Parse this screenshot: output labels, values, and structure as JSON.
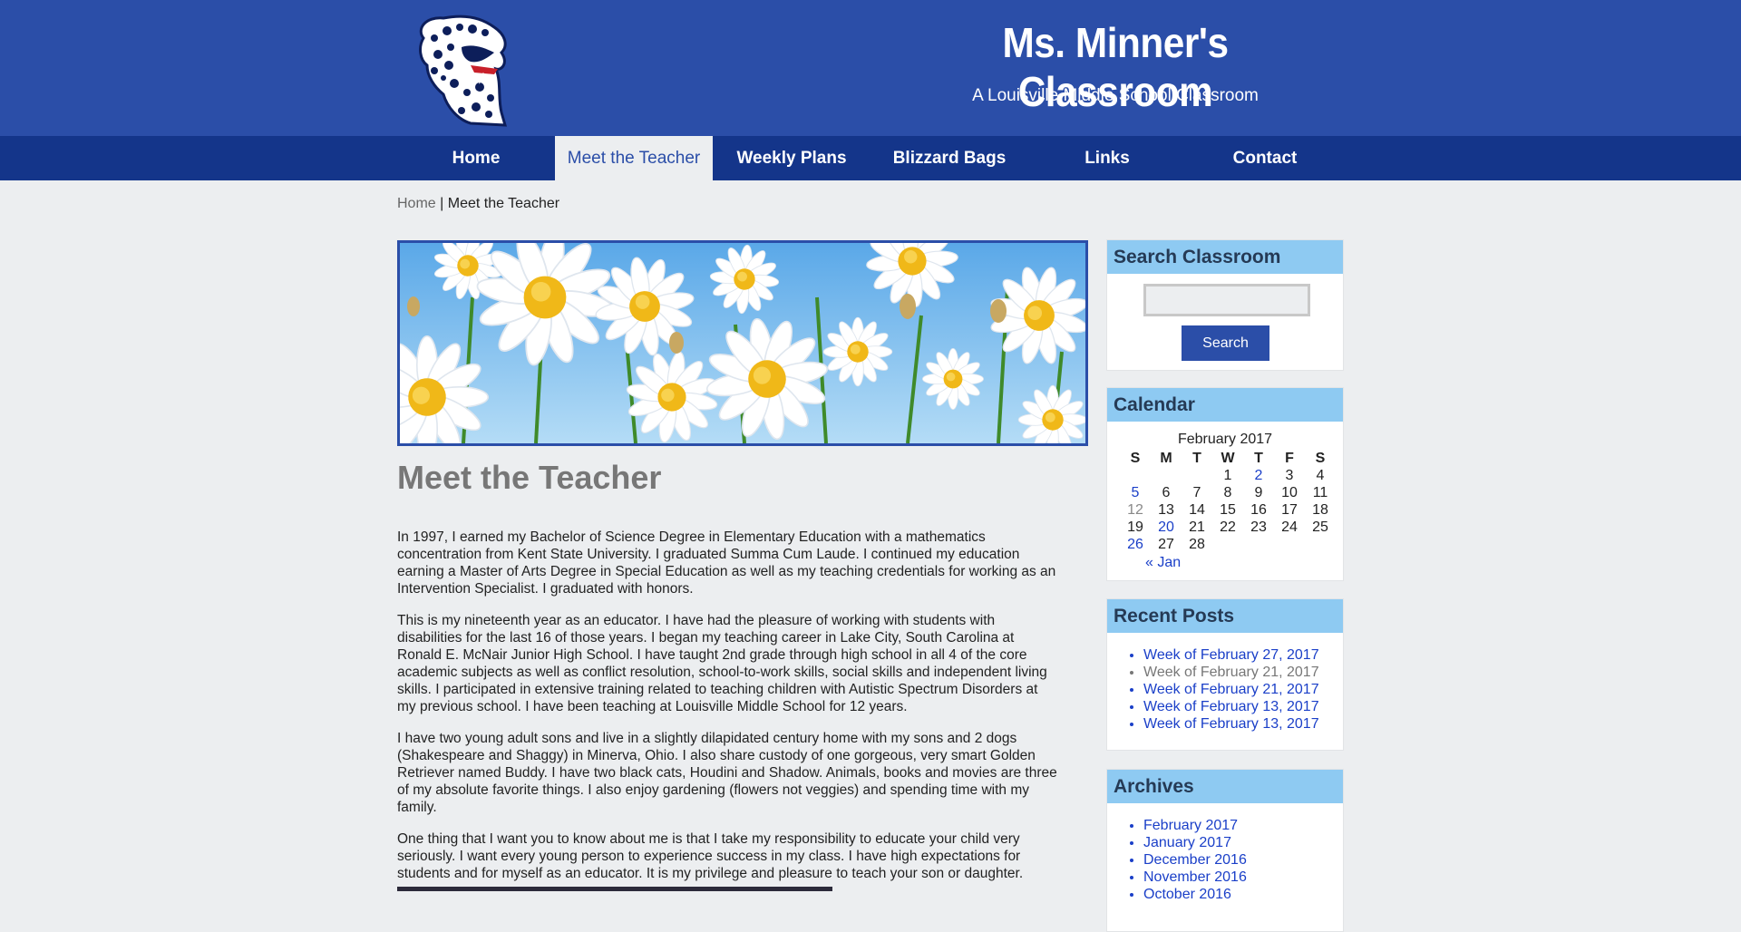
{
  "header": {
    "title": "Ms. Minner's Classroom",
    "subtitle": "A Louisville Middle School Classroom",
    "logo_icon": "jaguar-mascot-logo",
    "colors": {
      "header_bg": "#2b4ea8",
      "nav_bg": "#14358a",
      "widget_title_bg": "#8ecaf2"
    }
  },
  "nav": {
    "items": [
      {
        "label": "Home"
      },
      {
        "label": "Meet the Teacher"
      },
      {
        "label": "Weekly Plans"
      },
      {
        "label": "Blizzard Bags"
      },
      {
        "label": "Links"
      },
      {
        "label": "Contact"
      }
    ],
    "active": "Meet the Teacher"
  },
  "breadcrumb": {
    "home": "Home",
    "separator": " | ",
    "current": "Meet the Teacher"
  },
  "main": {
    "title": "Meet the Teacher",
    "paragraphs": [
      "In 1997, I earned my Bachelor of Science Degree in Elementary Education with a mathematics concentration from Kent State University. I graduated Summa Cum Laude. I continued my education earning a Master of Arts Degree in Special Education as well as my teaching credentials for working as an Intervention Specialist. I graduated with honors.",
      "This is my nineteenth year as an educator. I have had the pleasure of working with students with disabilities for the last 16 of those years. I began my teaching career in Lake City, South Carolina at Ronald E. McNair Junior High School. I have taught 2nd grade through high school in all 4 of the core academic subjects as well as conflict resolution, school-to-work skills, social skills and independent living skills. I participated in extensive training related to teaching children with Autistic Spectrum Disorders at my previous school. I have been teaching at Louisville Middle School for 12 years.",
      "I have two young adult sons and live in a slightly dilapidated century home with my sons and 2 dogs (Shakespeare and Shaggy) in Minerva, Ohio. I also share custody of one gorgeous, very smart Golden Retriever named Buddy. I have two black cats, Houdini and Shadow. Animals, books and movies are three of my absolute favorite things. I also enjoy gardening (flowers not veggies) and spending time with my family.",
      "One thing that I want you to know about me is that I take my responsibility to educate your child very seriously. I want every young person to experience success in my class. I have high expectations for students and for myself as an educator. It is my privilege and pleasure to teach your son or daughter."
    ]
  },
  "sidebar": {
    "search": {
      "title": "Search Classroom",
      "button": "Search",
      "value": ""
    },
    "calendar": {
      "title": "Calendar",
      "caption": "February 2017",
      "weekdays": [
        "S",
        "M",
        "T",
        "W",
        "T",
        "F",
        "S"
      ],
      "weeks": [
        [
          "",
          "",
          "",
          "1",
          "2",
          "3",
          "4"
        ],
        [
          "5",
          "6",
          "7",
          "8",
          "9",
          "10",
          "11"
        ],
        [
          "12",
          "13",
          "14",
          "15",
          "16",
          "17",
          "18"
        ],
        [
          "19",
          "20",
          "21",
          "22",
          "23",
          "24",
          "25"
        ],
        [
          "26",
          "27",
          "28",
          "",
          "",
          "",
          ""
        ]
      ],
      "linked_days": [
        "2",
        "5",
        "20",
        "26"
      ],
      "muted_days": [
        "12"
      ],
      "prev_link": "« Jan"
    },
    "recent_posts": {
      "title": "Recent Posts",
      "items": [
        {
          "label": "Week of February 27, 2017",
          "visited": false
        },
        {
          "label": "Week of February 21, 2017",
          "visited": true
        },
        {
          "label": "Week of February 21, 2017",
          "visited": false
        },
        {
          "label": "Week of February 13, 2017",
          "visited": false
        },
        {
          "label": "Week of February 13, 2017",
          "visited": false
        }
      ]
    },
    "archives": {
      "title": "Archives",
      "items": [
        {
          "label": "February 2017"
        },
        {
          "label": "January 2017"
        },
        {
          "label": "December 2016"
        },
        {
          "label": "November 2016"
        },
        {
          "label": "October 2016"
        }
      ]
    }
  }
}
